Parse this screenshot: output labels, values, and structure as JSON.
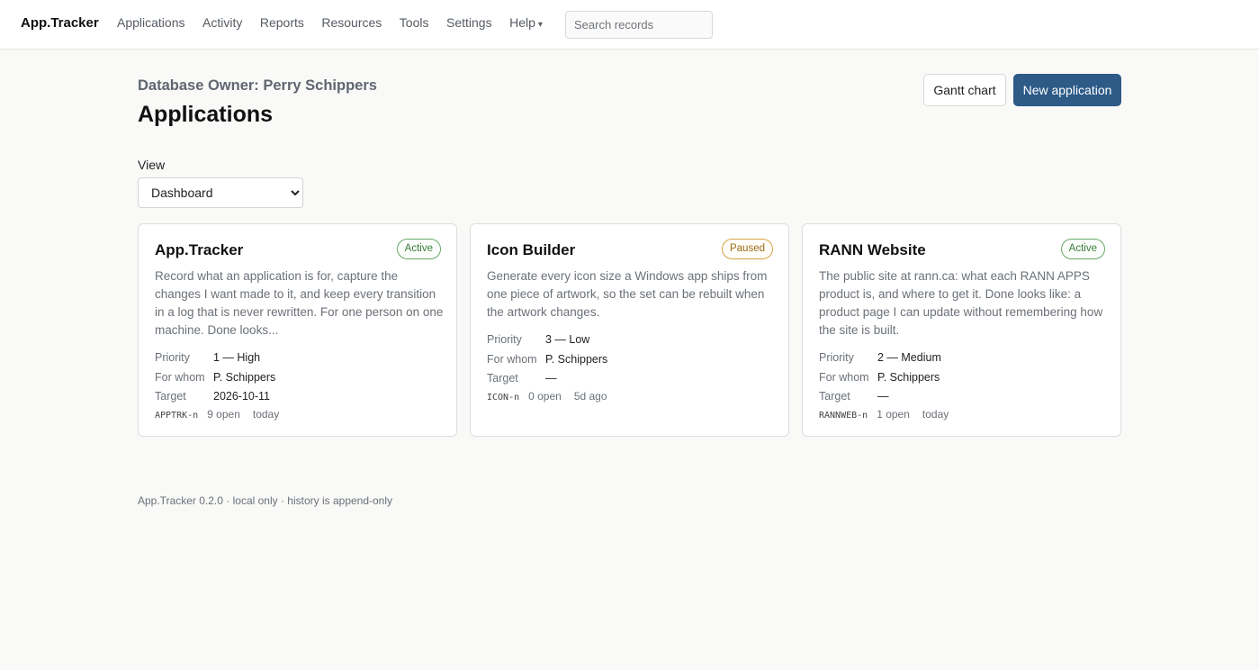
{
  "nav": {
    "brand": "App.Tracker",
    "links": [
      "Applications",
      "Activity",
      "Reports",
      "Resources",
      "Tools",
      "Settings"
    ],
    "help": "Help",
    "help_caret": "▾",
    "search_placeholder": "Search records"
  },
  "header": {
    "owner": "Database Owner: Perry Schippers",
    "title": "Applications",
    "gantt_label": "Gantt chart",
    "new_label": "New application",
    "view_label": "View",
    "view_selected": "Dashboard"
  },
  "cards": [
    {
      "title": "App.Tracker",
      "status": "Active",
      "description": "Record what an application is for, capture the changes I want made to it, and keep every transition in a log that is never rewritten. For one person on one machine. Done looks...",
      "priority_label": "Priority",
      "priority": "1 — High",
      "whom_label": "For whom",
      "whom": "P. Schippers",
      "target_label": "Target",
      "target": "2026-10-11",
      "code": "APPTRK-n",
      "open": "9 open",
      "updated": "today"
    },
    {
      "title": "Icon Builder",
      "status": "Paused",
      "description": "Generate every icon size a Windows app ships from one piece of artwork, so the set can be rebuilt when the artwork changes.",
      "priority_label": "Priority",
      "priority": "3 — Low",
      "whom_label": "For whom",
      "whom": "P. Schippers",
      "target_label": "Target",
      "target": "—",
      "code": "ICON-n",
      "open": "0 open",
      "updated": "5d ago"
    },
    {
      "title": "RANN Website",
      "status": "Active",
      "description": "The public site at rann.ca: what each RANN APPS product is, and where to get it. Done looks like: a product page I can update without remembering how the site is built.",
      "priority_label": "Priority",
      "priority": "2 — Medium",
      "whom_label": "For whom",
      "whom": "P. Schippers",
      "target_label": "Target",
      "target": "—",
      "code": "RANNWEB-n",
      "open": "1 open",
      "updated": "today"
    }
  ],
  "footer": "App.Tracker 0.2.0 · local only · history is append-only",
  "colors": {
    "primary": "#2d5a87",
    "active": "#3a7d3a",
    "paused": "#9a6a14"
  }
}
